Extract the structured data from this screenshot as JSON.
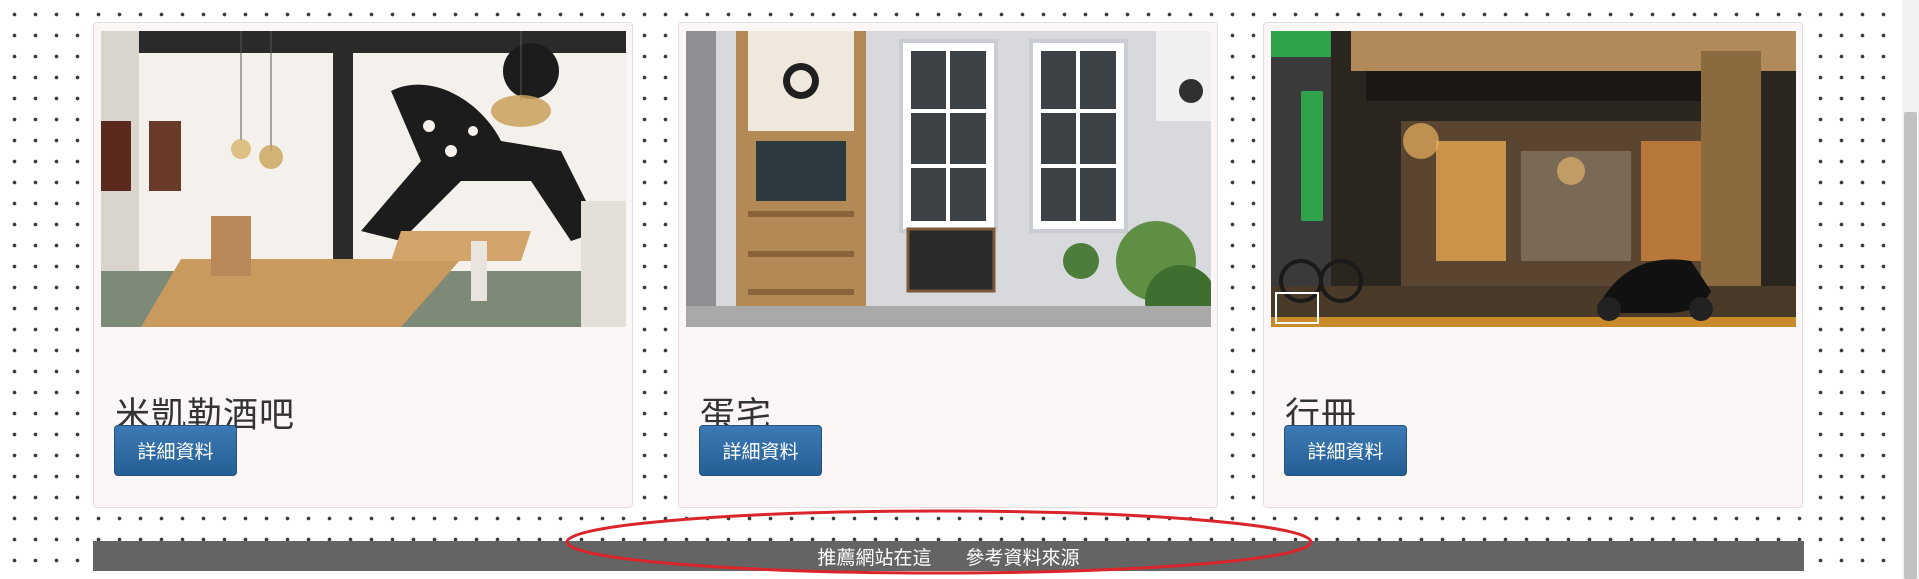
{
  "cards": [
    {
      "title": "米凱勒酒吧",
      "button_label": "詳細資料",
      "image": "bar-interior-photo"
    },
    {
      "title": "蛋宅",
      "button_label": "詳細資料",
      "image": "shop-front-photo"
    },
    {
      "title": "行冊",
      "button_label": "詳細資料",
      "image": "cafe-night-photo"
    }
  ],
  "footer": {
    "links": [
      "推薦網站在這",
      "參考資料來源"
    ],
    "background": "#646464"
  },
  "annotation": {
    "color": "#d9252b",
    "shape": "ellipse"
  },
  "colors": {
    "button": "#2d6aa3",
    "card_background": "#fcf6f6"
  }
}
